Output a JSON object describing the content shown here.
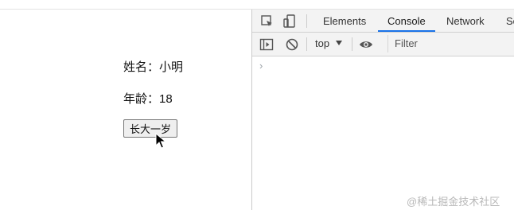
{
  "page": {
    "name_line": "姓名：小明",
    "age_line": "年龄：18",
    "grow_button": "长大一岁"
  },
  "devtools": {
    "tabs": [
      {
        "label": "Elements"
      },
      {
        "label": "Console"
      },
      {
        "label": "Network"
      },
      {
        "label": "So"
      }
    ],
    "active_tab": "Console",
    "context": "top",
    "filter_placeholder": "Filter",
    "prompt_symbol": "›"
  },
  "watermark": "@稀土掘金技术社区",
  "colors": {
    "accent": "#1a73e8",
    "toolbar_bg": "#f3f3f3"
  }
}
